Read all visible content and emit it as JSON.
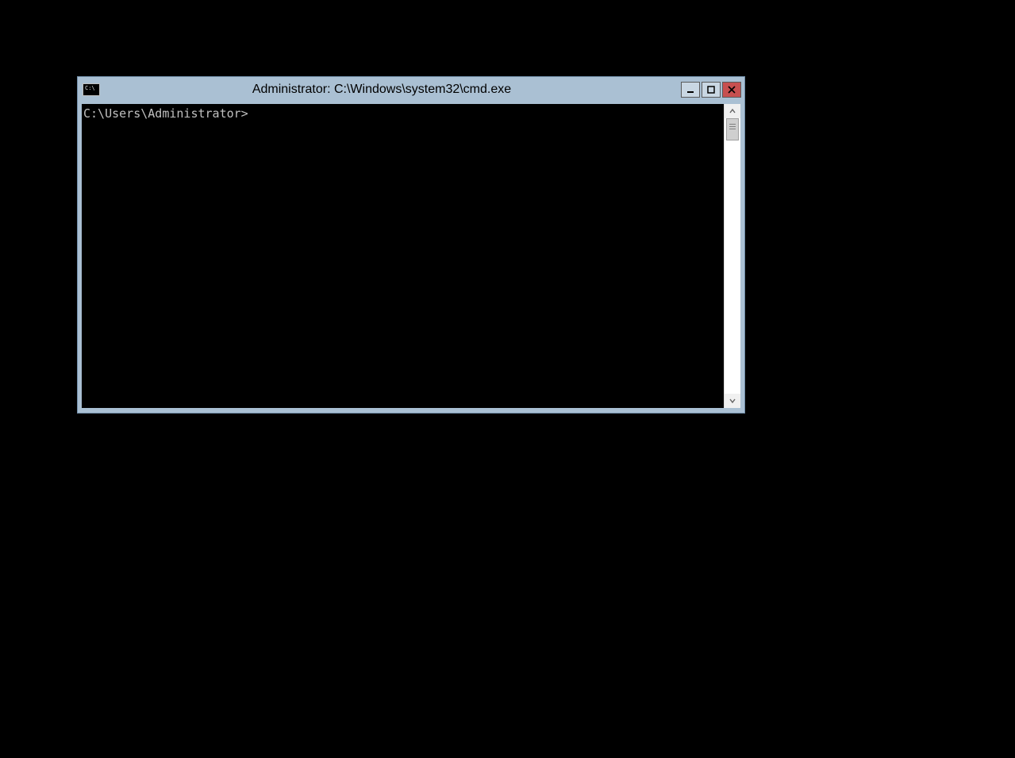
{
  "window": {
    "title": "Administrator: C:\\Windows\\system32\\cmd.exe"
  },
  "console": {
    "prompt": "C:\\Users\\Administrator>"
  }
}
